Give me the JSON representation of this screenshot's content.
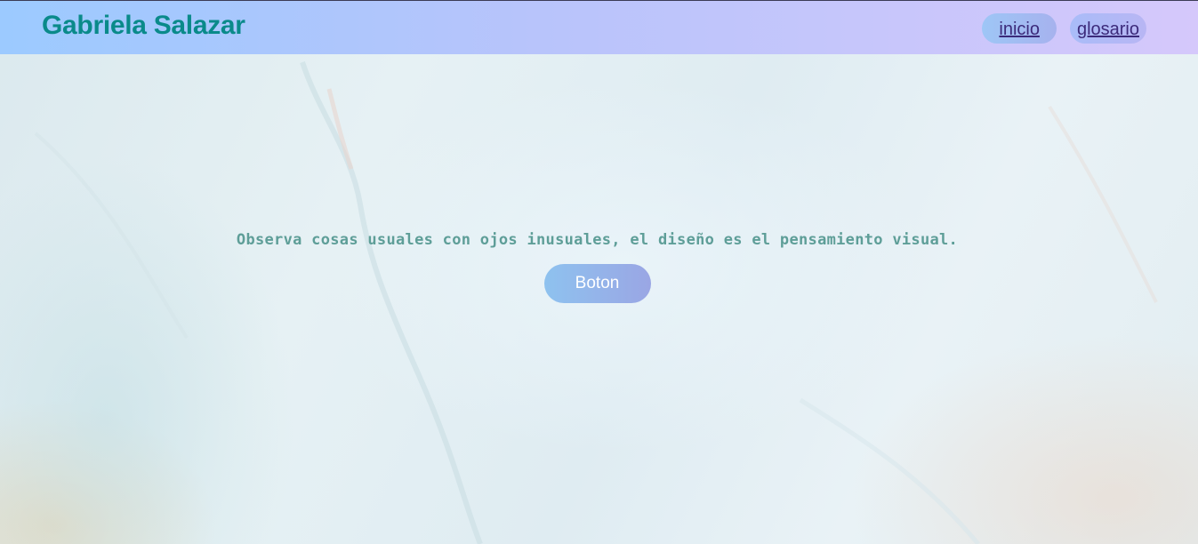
{
  "header": {
    "site_title": "Gabriela Salazar",
    "nav": [
      {
        "label": "inicio"
      },
      {
        "label": "glosario"
      }
    ]
  },
  "hero": {
    "quote": "Observa cosas usuales con ojos inusuales, el diseño es el pensamiento visual.",
    "button_label": "Boton"
  },
  "colors": {
    "title": "#0a8a8a",
    "nav_link": "#3c2a7a",
    "quote": "#5e9e98",
    "button_text": "#ffffff",
    "header_gradient": [
      "#9ccaff",
      "#d5c8fb"
    ]
  }
}
